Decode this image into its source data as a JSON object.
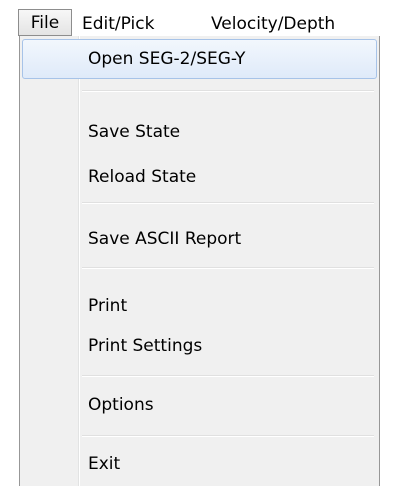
{
  "menubar": {
    "items": [
      {
        "label": "File"
      },
      {
        "label": "Edit/Pick"
      },
      {
        "label": "Velocity/Depth"
      }
    ]
  },
  "file_menu": {
    "items": [
      {
        "label": "Open SEG-2/SEG-Y"
      },
      {
        "label": "Save State"
      },
      {
        "label": "Reload State"
      },
      {
        "label": "Save ASCII Report"
      },
      {
        "label": "Print"
      },
      {
        "label": "Print Settings"
      },
      {
        "label": "Options"
      },
      {
        "label": "Exit"
      }
    ]
  },
  "colors": {
    "menu_background": "#f0f0f0",
    "hover_fill": "#dfeaf9",
    "hover_border": "#a7c3e8",
    "menu_border": "#979797"
  }
}
